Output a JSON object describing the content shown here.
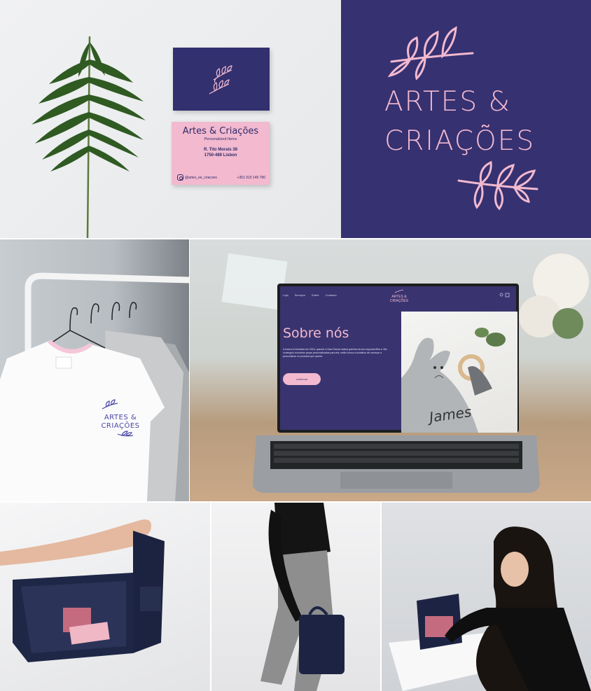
{
  "cards": {
    "brand": "Artes & Criações",
    "subtitle": "Personalized Items",
    "street": "R. Tito Morais 38",
    "city": "1750-489 Lisbon",
    "instagram": "@artes_ee_criacoes",
    "phone": "+351 919 145 780"
  },
  "logo": {
    "line1": "ARTES &",
    "line2": "CRIAÇÕES"
  },
  "shirt": {
    "line1": "ARTES &",
    "line2": "CRIAÇÕES"
  },
  "website": {
    "nav": [
      "Loja",
      "Serviços",
      "Sobre",
      "Contacto"
    ],
    "brand": "ARTES & CRIAÇÕES",
    "heading": "Sobre nós",
    "paragraph": "A marca foi fundada em 2016, quando a Sara Garcia estava grávida da sua segunda filha e não conseguiu encontrar peças personalizadas para ela, então tomou a iniciativa de começar a personalizar os produtos que queria.",
    "button": "continuar",
    "photo_text": "James"
  },
  "colors": {
    "navy": "#363171",
    "pink": "#f2b9cf"
  }
}
